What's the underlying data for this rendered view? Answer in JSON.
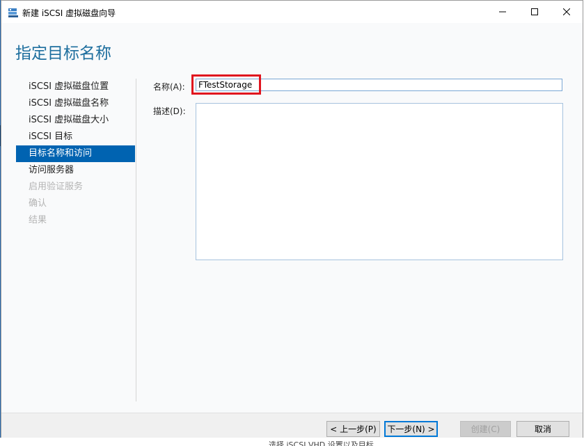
{
  "window": {
    "title": "新建 iSCSI 虚拟磁盘向导",
    "icon": "wizard-app-icon"
  },
  "page": {
    "title": "指定目标名称"
  },
  "steps": [
    {
      "label": "iSCSI 虚拟磁盘位置",
      "state": "normal"
    },
    {
      "label": "iSCSI 虚拟磁盘名称",
      "state": "normal"
    },
    {
      "label": "iSCSI 虚拟磁盘大小",
      "state": "normal"
    },
    {
      "label": "iSCSI 目标",
      "state": "normal"
    },
    {
      "label": "目标名称和访问",
      "state": "active"
    },
    {
      "label": "访问服务器",
      "state": "normal"
    },
    {
      "label": "启用验证服务",
      "state": "disabled"
    },
    {
      "label": "确认",
      "state": "disabled"
    },
    {
      "label": "结果",
      "state": "disabled"
    }
  ],
  "form": {
    "name_label": "名称(A):",
    "name_value": "FTestStorage",
    "desc_label": "描述(D):",
    "desc_value": ""
  },
  "buttons": {
    "prev": "< 上一步(P)",
    "next": "下一步(N) >",
    "create": "创建(C)",
    "cancel": "取消"
  },
  "background_text": "选择 iSCSI VHD 设置以及目标",
  "colors": {
    "accent": "#0063b1",
    "title": "#1d6e9e",
    "highlight": "#e0141e"
  }
}
